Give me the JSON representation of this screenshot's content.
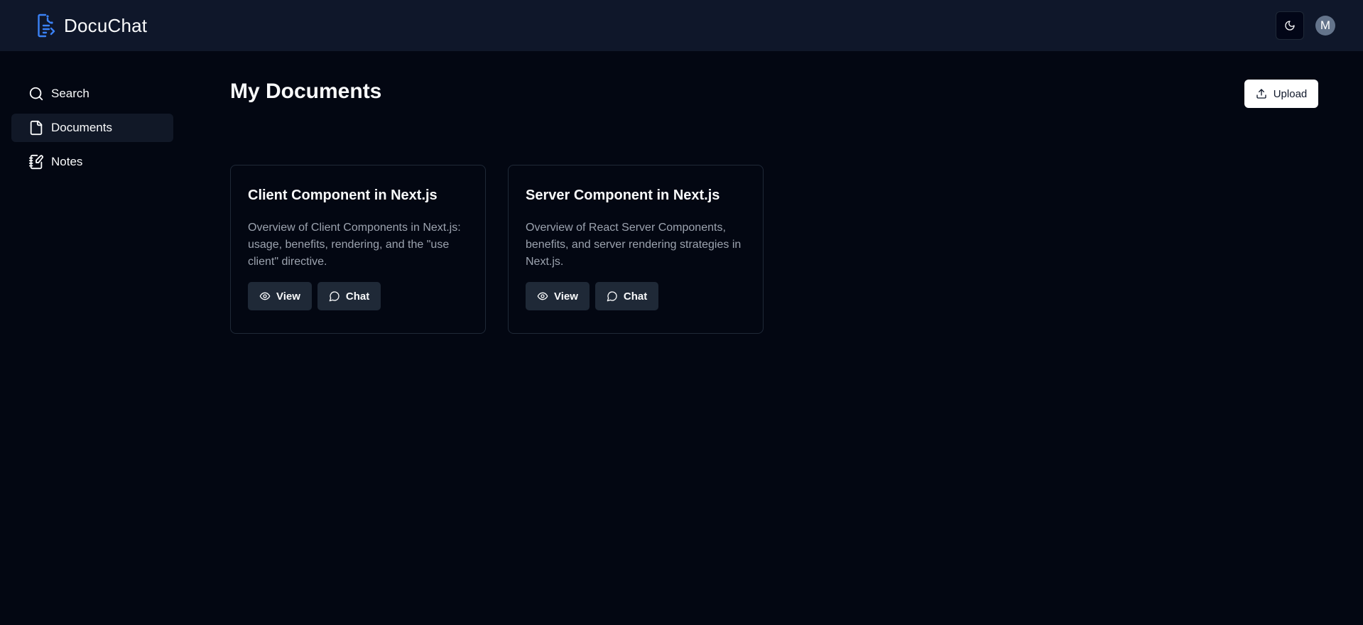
{
  "header": {
    "brand_name": "DocuChat",
    "brand_icon": "document-list-icon",
    "theme_toggle_icon": "moon-icon",
    "avatar_initial": "M",
    "accent_color": "#3b82f6"
  },
  "sidebar": {
    "items": [
      {
        "label": "Search",
        "icon": "search-icon",
        "active": false
      },
      {
        "label": "Documents",
        "icon": "file-icon",
        "active": true
      },
      {
        "label": "Notes",
        "icon": "notebook-pen-icon",
        "active": false
      }
    ]
  },
  "main": {
    "title": "My Documents",
    "upload_label": "Upload",
    "upload_icon": "upload-icon",
    "documents": [
      {
        "title": "Client Component in Next.js",
        "description": "Overview of Client Components in Next.js: usage, benefits, rendering, and the \"use client\" directive.",
        "view_label": "View",
        "chat_label": "Chat"
      },
      {
        "title": "Server Component in Next.js",
        "description": "Overview of React Server Components, benefits, and server rendering strategies in Next.js.",
        "view_label": "View",
        "chat_label": "Chat"
      }
    ]
  }
}
